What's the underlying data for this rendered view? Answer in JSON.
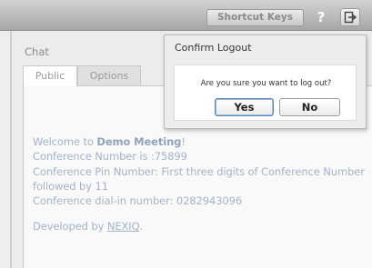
{
  "toolbar": {
    "shortcut_keys_label": "Shortcut Keys",
    "help_label": "?",
    "logout_icon": "sign-out-icon"
  },
  "chat": {
    "title": "Chat",
    "tabs": [
      {
        "label": "Public",
        "selected": true
      },
      {
        "label": "Options",
        "selected": false
      }
    ],
    "welcome_prefix": "Welcome to ",
    "meeting_name": "Demo Meeting",
    "welcome_suffix": "!",
    "conference_number": "Conference Number is :75899",
    "pin_line": "Conference Pin Number: First three digits of Conference Number followed by 11",
    "dialin_line": "Conference dial-in number: 0282943096",
    "developed_prefix": "Developed by ",
    "developer_link": "NEXIQ",
    "developed_suffix": "."
  },
  "dialog": {
    "title": "Confirm Logout",
    "message": "Are you sure you want to log out?",
    "yes_label": "Yes",
    "no_label": "No"
  },
  "colors": {
    "toolbar_top": "#d3d3d3",
    "toolbar_bottom": "#a6a6a6",
    "chat_text": "#a3b4c8",
    "dialog_focus": "#5a86b8"
  }
}
